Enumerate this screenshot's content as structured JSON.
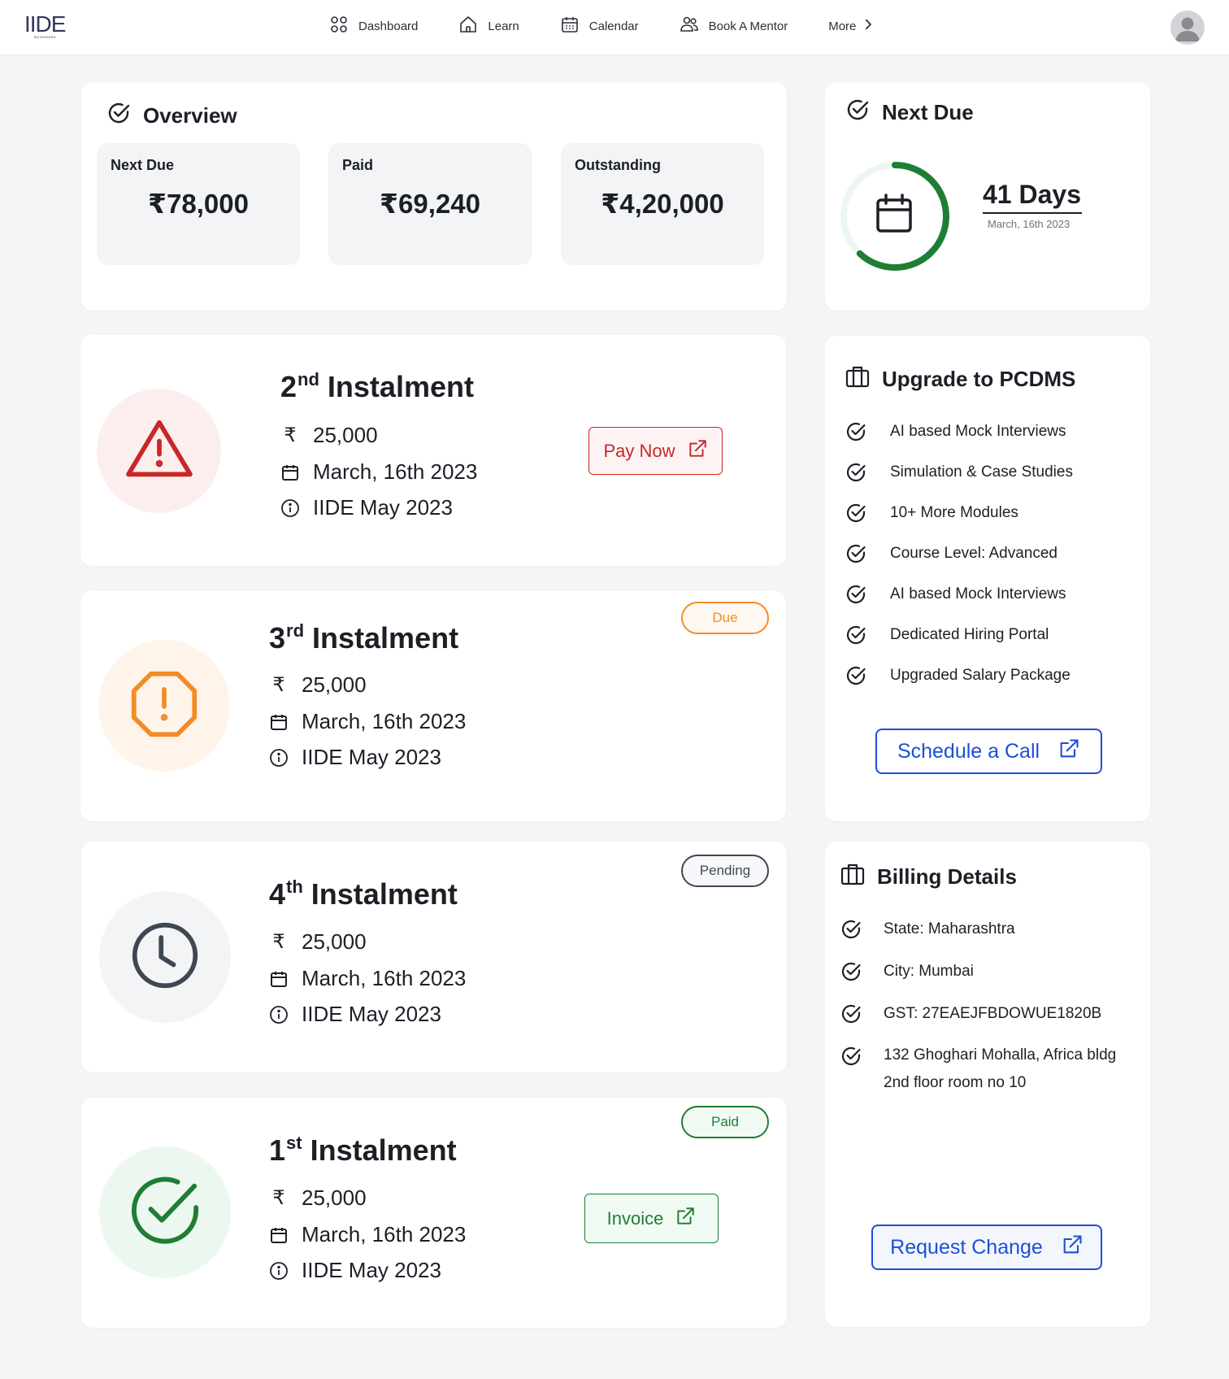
{
  "brand": {
    "logo_text": "IIDE",
    "logo_sub": "BOOKMARK"
  },
  "nav": {
    "items": [
      {
        "label": "Dashboard",
        "icon": "grid-icon"
      },
      {
        "label": "Learn",
        "icon": "home-icon"
      },
      {
        "label": "Calendar",
        "icon": "calendar-icon"
      },
      {
        "label": "Book A Mentor",
        "icon": "users-icon"
      }
    ],
    "more_label": "More"
  },
  "overview": {
    "title": "Overview",
    "stats": [
      {
        "label": "Next Due",
        "value": "₹78,000"
      },
      {
        "label": "Paid",
        "value": "₹69,240"
      },
      {
        "label": "Outstanding",
        "value": "₹4,20,000"
      }
    ]
  },
  "next_due": {
    "title": "Next Due",
    "days": "41 Days",
    "date": "March, 16th 2023",
    "progress_fraction": 0.62,
    "color": "#1e7e34"
  },
  "instalments": [
    {
      "ordinal": "2",
      "suffix": "nd",
      "word": "Instalment",
      "amount": "25,000",
      "date": "March, 16th 2023",
      "batch": "IIDE May 2023",
      "status_icon": "warning-triangle-icon",
      "status": "",
      "action_label": "Pay Now",
      "color": "#c62828"
    },
    {
      "ordinal": "3",
      "suffix": "rd",
      "word": "Instalment",
      "amount": "25,000",
      "date": "March, 16th 2023",
      "batch": "IIDE May 2023",
      "status_icon": "alert-octagon-icon",
      "status": "Due",
      "color": "#f28c28"
    },
    {
      "ordinal": "4",
      "suffix": "th",
      "word": "Instalment",
      "amount": "25,000",
      "date": "March, 16th 2023",
      "batch": "IIDE May 2023",
      "status_icon": "clock-icon",
      "status": "Pending",
      "color": "#3f4654"
    },
    {
      "ordinal": "1",
      "suffix": "st",
      "word": "Instalment",
      "amount": "25,000",
      "date": "March, 16th 2023",
      "batch": "IIDE May 2023",
      "status_icon": "check-circle-icon",
      "status": "Paid",
      "action_label": "Invoice",
      "color": "#1e7e34"
    }
  ],
  "upgrade": {
    "title": "Upgrade to PCDMS",
    "features": [
      "AI based Mock Interviews",
      "Simulation & Case Studies",
      "10+ More Modules",
      "Course Level: Advanced",
      "AI based Mock Interviews",
      "Dedicated Hiring Portal",
      "Upgraded Salary Package"
    ],
    "cta": "Schedule a Call"
  },
  "billing": {
    "title": "Billing Details",
    "state": "State: Maharashtra",
    "city": "City: Mumbai",
    "gst": "GST: 27EAEJFBDOWUE1820B",
    "address_line1": "132 Ghoghari Mohalla, Africa bldg",
    "address_line2": "2nd floor room no 10",
    "cta": "Request Change"
  },
  "colors": {
    "accent_blue": "#1d4fd8",
    "danger": "#c62828",
    "warning": "#f28c28",
    "success": "#1e7e34",
    "neutral": "#3f4654"
  }
}
